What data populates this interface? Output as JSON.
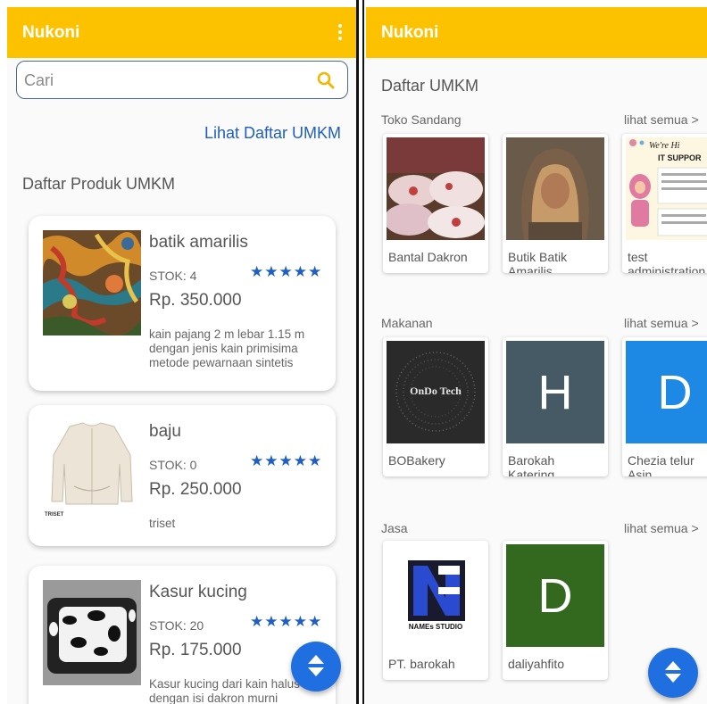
{
  "left_screen": {
    "app_title": "Nukoni",
    "search_placeholder": "Cari",
    "link_label": "Lihat Daftar UMKM",
    "section_title": "Daftar Produk UMKM",
    "products": [
      {
        "name": "batik amarilis",
        "stok": "STOK: 4",
        "stars": "★★★★★",
        "price": "Rp.  350.000",
        "desc": "kain pajang  2 m lebar 1.15 m dengan jenis kain primisima metode pewarnaan sintetis"
      },
      {
        "name": "baju",
        "stok": "STOK: 0",
        "stars": "★★★★★",
        "price": "Rp.  250.000",
        "desc": "triset",
        "img_caption": "TRISET"
      },
      {
        "name": "Kasur kucing",
        "stok": "STOK: 20",
        "stars": "★★★★★",
        "price": "Rp.  175.000",
        "desc": "Kasur kucing dari kain halus dengan isi dakron murni"
      }
    ]
  },
  "right_screen": {
    "app_title": "Nukoni",
    "page_title": "Daftar UMKM",
    "categories": [
      {
        "label": "Toko Sandang",
        "more": "lihat semua >",
        "stores": [
          {
            "name": "Bantal Dakron"
          },
          {
            "name": "Butik Batik\nAmarilis"
          },
          {
            "name": "test\nadministration",
            "img_text_1": "We're Hi",
            "img_text_2": "IT SUPPOR"
          }
        ]
      },
      {
        "label": "Makanan",
        "more": "lihat semua >",
        "stores": [
          {
            "name": "BOBakery",
            "img_text": "OnDo Tech"
          },
          {
            "name": "Barokah\nKatering",
            "letter": "H"
          },
          {
            "name": "Chezia telur\nAsin",
            "letter": "D"
          }
        ]
      },
      {
        "label": "Jasa",
        "more": "lihat semua >",
        "stores": [
          {
            "name": "PT. barokah",
            "img_text": "NAMEs STUDIO"
          },
          {
            "name": "daliyahfito",
            "letter": "D"
          }
        ]
      }
    ]
  },
  "colors": {
    "appbar": "#fcc200",
    "accent_blue": "#1f6fe0",
    "link_blue": "#1f5fbf",
    "tile_slate": "#455a64",
    "tile_blue": "#1e88e5",
    "tile_green": "#33691e"
  },
  "icons": [
    "more-vert-icon",
    "search-icon",
    "scroll-toggle-icon"
  ]
}
